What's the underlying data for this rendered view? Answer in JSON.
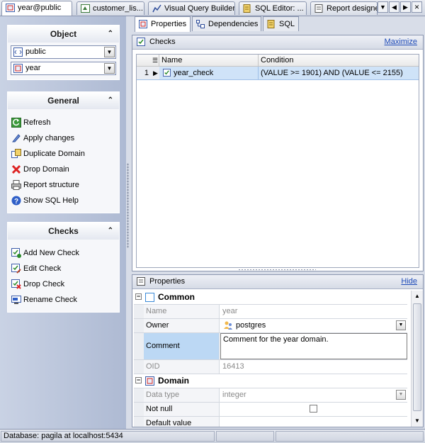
{
  "doc_tabs": [
    {
      "label": "year@public"
    },
    {
      "label": "customer_lis..."
    },
    {
      "label": "Visual Query Builder"
    },
    {
      "label": "SQL Editor: ..."
    },
    {
      "label": "Report designe"
    }
  ],
  "nav_buttons": [
    "▼",
    "◀",
    "▶",
    "✕"
  ],
  "sidebar": {
    "object": {
      "title": "Object",
      "combo1": "public",
      "combo2": "year"
    },
    "general": {
      "title": "General",
      "items": [
        {
          "label": "Refresh",
          "icon": "refresh-icon"
        },
        {
          "label": "Apply changes",
          "icon": "apply-icon"
        },
        {
          "label": "Duplicate Domain",
          "icon": "duplicate-icon"
        },
        {
          "label": "Drop Domain",
          "icon": "drop-icon"
        },
        {
          "label": "Report structure",
          "icon": "printer-icon"
        },
        {
          "label": "Show SQL Help",
          "icon": "help-icon"
        }
      ]
    },
    "checks": {
      "title": "Checks",
      "items": [
        {
          "label": "Add New Check",
          "icon": "add-check-icon"
        },
        {
          "label": "Edit Check",
          "icon": "edit-check-icon"
        },
        {
          "label": "Drop Check",
          "icon": "drop-check-icon"
        },
        {
          "label": "Rename Check",
          "icon": "rename-check-icon"
        }
      ]
    }
  },
  "sub_tabs": [
    {
      "label": "Properties"
    },
    {
      "label": "Dependencies"
    },
    {
      "label": "SQL"
    }
  ],
  "checks_panel": {
    "title": "Checks",
    "maximize": "Maximize",
    "columns": [
      "Name",
      "Condition"
    ],
    "rows": [
      {
        "num": "1",
        "name": "year_check",
        "condition": "(VALUE >= 1901) AND (VALUE <= 2155)"
      }
    ]
  },
  "properties_panel": {
    "title": "Properties",
    "hide": "Hide",
    "common_label": "Common",
    "name_label": "Name",
    "name_value": "year",
    "owner_label": "Owner",
    "owner_value": "postgres",
    "comment_label": "Comment",
    "comment_value": "Comment for the year domain.",
    "oid_label": "OID",
    "oid_value": "16413",
    "domain_label": "Domain",
    "datatype_label": "Data type",
    "datatype_value": "integer",
    "notnull_label": "Not null",
    "default_label": "Default value"
  },
  "status": {
    "database": "Database: pagila at localhost:5434"
  },
  "colors": {
    "accent": "#1e4bb8",
    "selection": "#cfe3f8"
  }
}
